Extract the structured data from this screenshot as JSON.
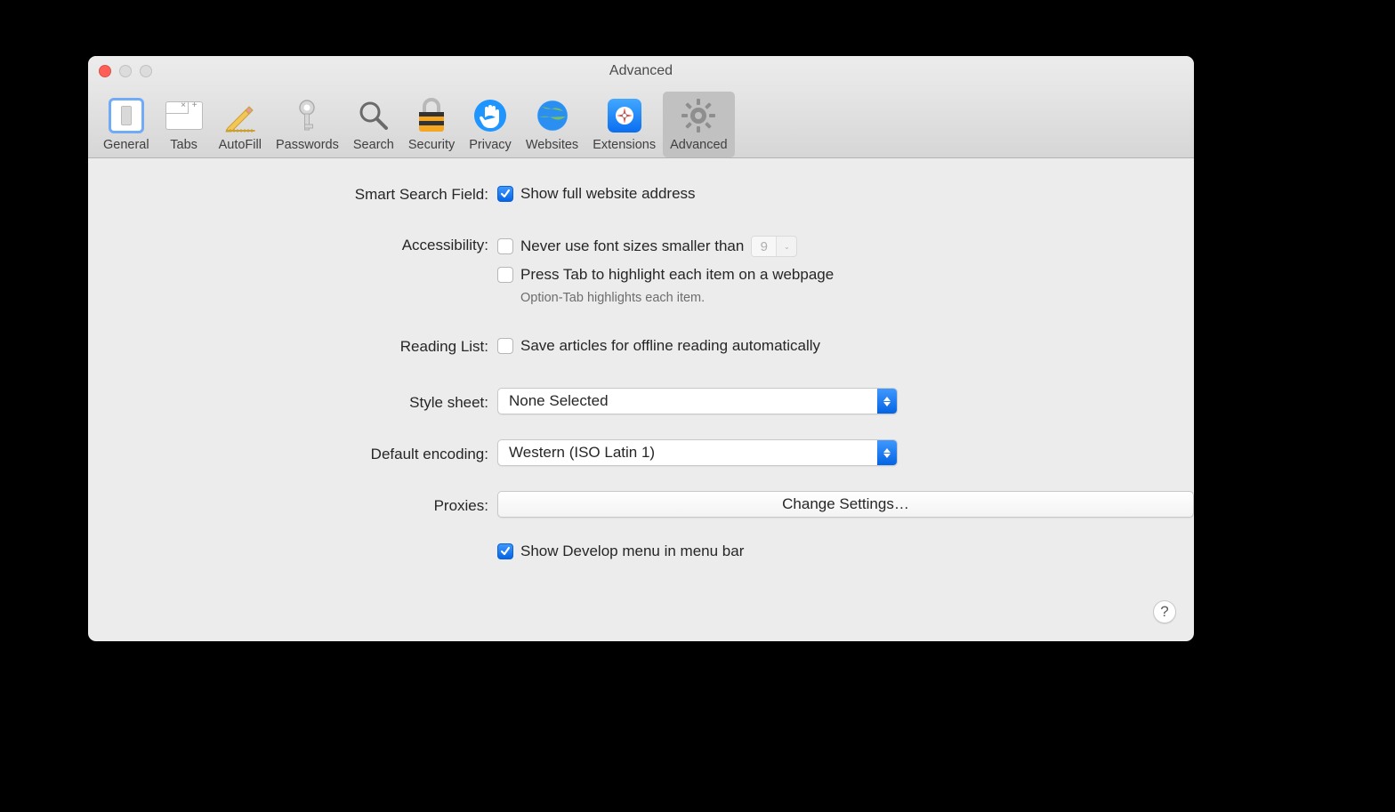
{
  "window": {
    "title": "Advanced"
  },
  "toolbar": {
    "items": [
      {
        "label": "General"
      },
      {
        "label": "Tabs"
      },
      {
        "label": "AutoFill"
      },
      {
        "label": "Passwords"
      },
      {
        "label": "Search"
      },
      {
        "label": "Security"
      },
      {
        "label": "Privacy"
      },
      {
        "label": "Websites"
      },
      {
        "label": "Extensions"
      },
      {
        "label": "Advanced"
      }
    ]
  },
  "form": {
    "smart_search": {
      "label": "Smart Search Field:",
      "show_full_address": "Show full website address"
    },
    "accessibility": {
      "label": "Accessibility:",
      "min_font": "Never use font sizes smaller than",
      "min_font_value": "9",
      "press_tab": "Press Tab to highlight each item on a webpage",
      "hint": "Option-Tab highlights each item."
    },
    "reading_list": {
      "label": "Reading List:",
      "save_offline": "Save articles for offline reading automatically"
    },
    "style_sheet": {
      "label": "Style sheet:",
      "value": "None Selected"
    },
    "default_encoding": {
      "label": "Default encoding:",
      "value": "Western (ISO Latin 1)"
    },
    "proxies": {
      "label": "Proxies:",
      "button": "Change Settings…"
    },
    "develop": {
      "label": "Show Develop menu in menu bar"
    }
  },
  "help": "?"
}
